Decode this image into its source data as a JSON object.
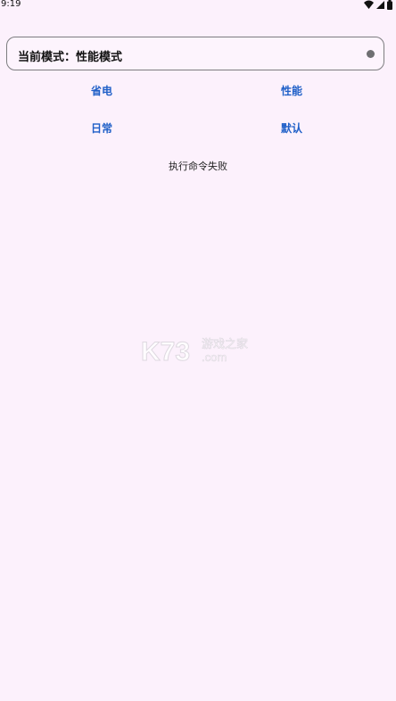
{
  "status_bar": {
    "time": "9:19"
  },
  "mode_card": {
    "label": "当前模式：性能模式"
  },
  "buttons": {
    "power_save": "省电",
    "performance": "性能",
    "daily": "日常",
    "default": "默认"
  },
  "result_text": "执行命令失败",
  "watermark": {
    "text": "游戏之家",
    "logo": "K73",
    "domain": ".com"
  },
  "colors": {
    "background": "#fcf1fc",
    "accent": "#2060c8"
  }
}
